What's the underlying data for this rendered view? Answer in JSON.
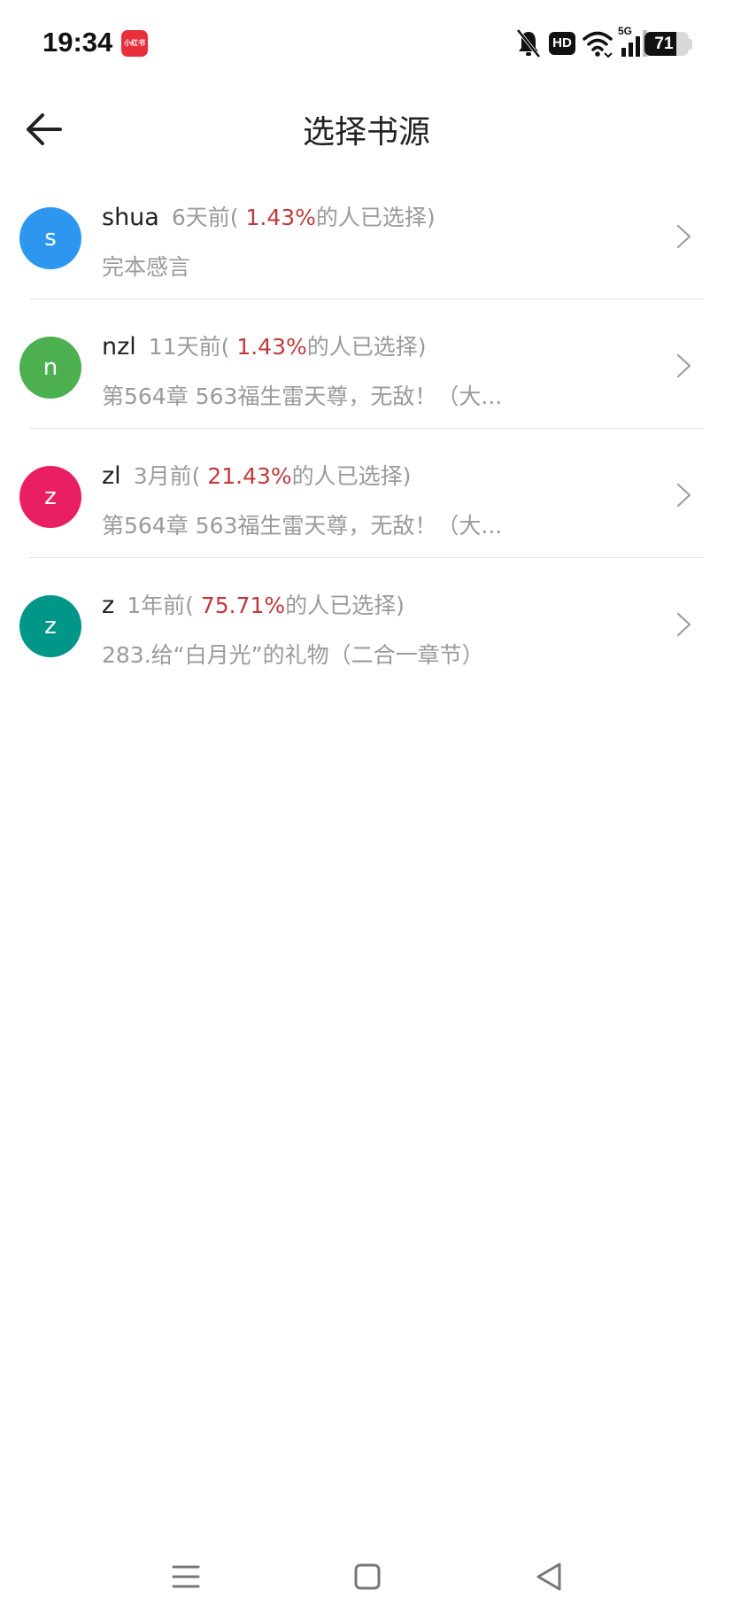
{
  "status_bar": {
    "time": "19:34",
    "app_badge_text": "小红书",
    "hd_label": "HD",
    "network_label": "5G",
    "battery_level": "71",
    "icons": [
      "bell-muted-icon",
      "hd-icon",
      "wifi-icon",
      "signal-5g-icon",
      "battery-icon"
    ]
  },
  "header": {
    "title": "选择书源",
    "back_icon": "arrow-left-icon"
  },
  "sources": [
    {
      "avatar_letter": "s",
      "avatar_color": "#2d97f0",
      "name": "shua",
      "age": "6天前(",
      "percent": " 1.43%",
      "suffix": "的人已选择)",
      "latest": "完本感言"
    },
    {
      "avatar_letter": "n",
      "avatar_color": "#4caf50",
      "name": "nzl",
      "age": "11天前(",
      "percent": " 1.43%",
      "suffix": "的人已选择)",
      "latest": "第564章 563福生雷天尊，无敌！（大..."
    },
    {
      "avatar_letter": "z",
      "avatar_color": "#e91e63",
      "name": "zl",
      "age": "3月前(",
      "percent": " 21.43%",
      "suffix": "的人已选择)",
      "latest": "第564章 563福生雷天尊，无敌！（大..."
    },
    {
      "avatar_letter": "z",
      "avatar_color": "#009688",
      "name": "z",
      "age": "1年前(",
      "percent": " 75.71%",
      "suffix": "的人已选择)",
      "latest": "283.给“白月光”的礼物（二合一章节）"
    }
  ],
  "colors": {
    "percent_highlight": "#c0393b",
    "meta_gray": "#9a9a9a",
    "title_text": "#222222"
  },
  "nav_bar": {
    "icons": [
      "menu-icon",
      "home-square-icon",
      "back-triangle-icon"
    ]
  }
}
